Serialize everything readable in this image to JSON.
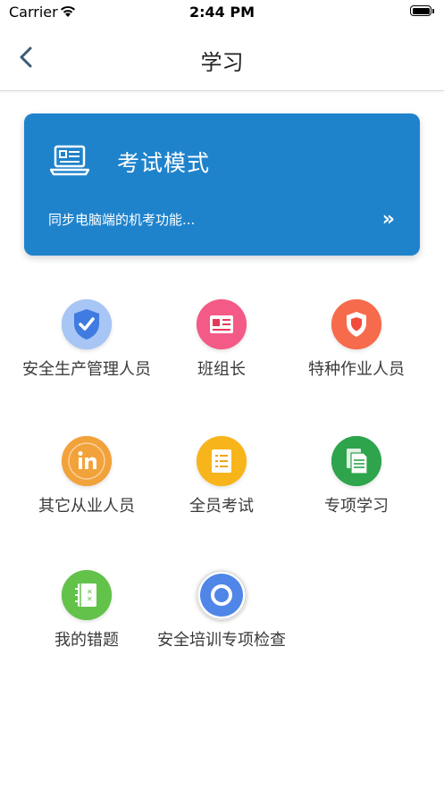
{
  "status_bar": {
    "carrier": "Carrier",
    "time": "2:44 PM"
  },
  "nav": {
    "title": "学习"
  },
  "exam_card": {
    "title": "考试模式",
    "subtitle": "同步电脑端的机考功能...",
    "chevron": "»",
    "color": "#1f83cc"
  },
  "grid": [
    {
      "label": "安全生产管理人员",
      "icon": "shield-check-icon",
      "color": "#8fb6f2"
    },
    {
      "label": "班组长",
      "icon": "id-card-icon",
      "color": "#f25c8a"
    },
    {
      "label": "特种作业人员",
      "icon": "shield-icon",
      "color": "#f56a4a"
    },
    {
      "label": "其它从业人员",
      "icon": "linkedin-icon",
      "color": "#f2a03a"
    },
    {
      "label": "全员考试",
      "icon": "checklist-icon",
      "color": "#f6b51d"
    },
    {
      "label": "专项学习",
      "icon": "documents-icon",
      "color": "#2ca34a"
    },
    {
      "label": "我的错题",
      "icon": "notebook-icon",
      "color": "#62c04a"
    },
    {
      "label": "安全培训专项检查",
      "icon": "circle-icon",
      "color": "#4f86e8"
    }
  ]
}
